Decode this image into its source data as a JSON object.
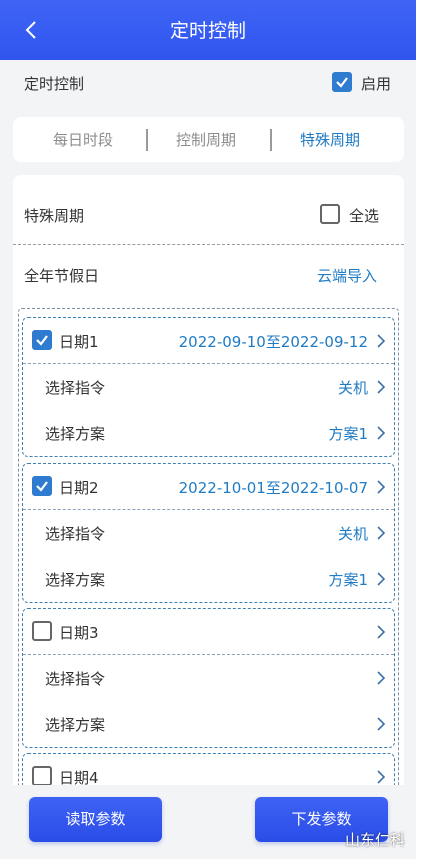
{
  "header": {
    "title": "定时控制",
    "back_icon": "chevron-left-icon"
  },
  "enable_row": {
    "label": "定时控制",
    "checkbox_label": "启用",
    "checked": true
  },
  "tabs": [
    {
      "label": "每日时段",
      "active": false
    },
    {
      "label": "控制周期",
      "active": false
    },
    {
      "label": "特殊周期",
      "active": true
    }
  ],
  "special": {
    "label": "特殊周期",
    "select_all_label": "全选",
    "select_all_checked": false,
    "holiday_label": "全年节假日",
    "cloud_import_label": "云端导入"
  },
  "dates": [
    {
      "label": "日期1",
      "checked": true,
      "range": "2022-09-10至2022-09-12",
      "command_label": "选择指令",
      "command_value": "关机",
      "plan_label": "选择方案",
      "plan_value": "方案1"
    },
    {
      "label": "日期2",
      "checked": true,
      "range": "2022-10-01至2022-10-07",
      "command_label": "选择指令",
      "command_value": "关机",
      "plan_label": "选择方案",
      "plan_value": "方案1"
    },
    {
      "label": "日期3",
      "checked": false,
      "range": "",
      "command_label": "选择指令",
      "command_value": "",
      "plan_label": "选择方案",
      "plan_value": ""
    },
    {
      "label": "日期4",
      "checked": false
    }
  ],
  "footer": {
    "read_label": "读取参数",
    "send_label": "下发参数"
  },
  "watermark": "山东仁科",
  "colors": {
    "primary": "#2f55ef",
    "accent_text": "#1f7bc4",
    "checkbox_on": "#2f7bd0"
  }
}
